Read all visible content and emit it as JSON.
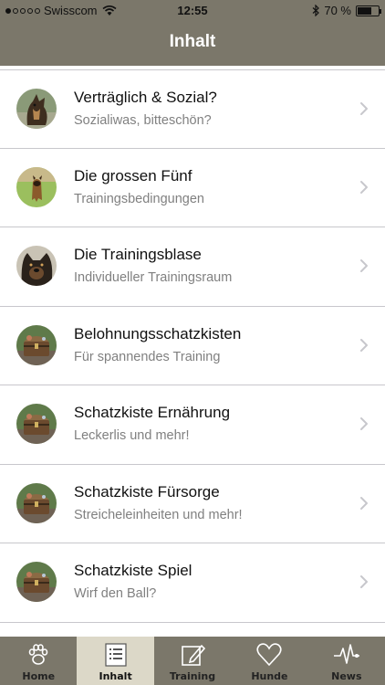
{
  "status": {
    "carrier": "Swisscom",
    "time": "12:55",
    "battery": "70 %",
    "battery_level": 0.7
  },
  "header": {
    "title": "Inhalt"
  },
  "items": [
    {
      "title": "Verträglich & Sozial?",
      "subtitle": "Sozialiwas, bitteschön?",
      "avatar": "dog-portrait"
    },
    {
      "title": "Die grossen Fünf",
      "subtitle": "Trainingsbedingungen",
      "avatar": "dog-on-grass"
    },
    {
      "title": "Die Trainingsblase",
      "subtitle": "Individueller Trainingsraum",
      "avatar": "dog-face"
    },
    {
      "title": "Belohnungsschatzkisten",
      "subtitle": "Für spannendes Training",
      "avatar": "treasure-chest"
    },
    {
      "title": "Schatzkiste Ernährung",
      "subtitle": "Leckerlis und mehr!",
      "avatar": "treasure-chest"
    },
    {
      "title": "Schatzkiste Fürsorge",
      "subtitle": "Streicheleinheiten und mehr!",
      "avatar": "treasure-chest"
    },
    {
      "title": "Schatzkiste Spiel",
      "subtitle": "Wirf den Ball?",
      "avatar": "treasure-chest"
    }
  ],
  "tabs": [
    {
      "label": "Home",
      "icon": "paw-icon",
      "active": false
    },
    {
      "label": "Inhalt",
      "icon": "list-icon",
      "active": true
    },
    {
      "label": "Training",
      "icon": "edit-icon",
      "active": false
    },
    {
      "label": "Hunde",
      "icon": "heart-icon",
      "active": false
    },
    {
      "label": "News",
      "icon": "pulse-icon",
      "active": false
    }
  ],
  "colors": {
    "bar": "#7b776a",
    "active_tab": "#dcd8c8",
    "separator": "#c8c7cc"
  }
}
